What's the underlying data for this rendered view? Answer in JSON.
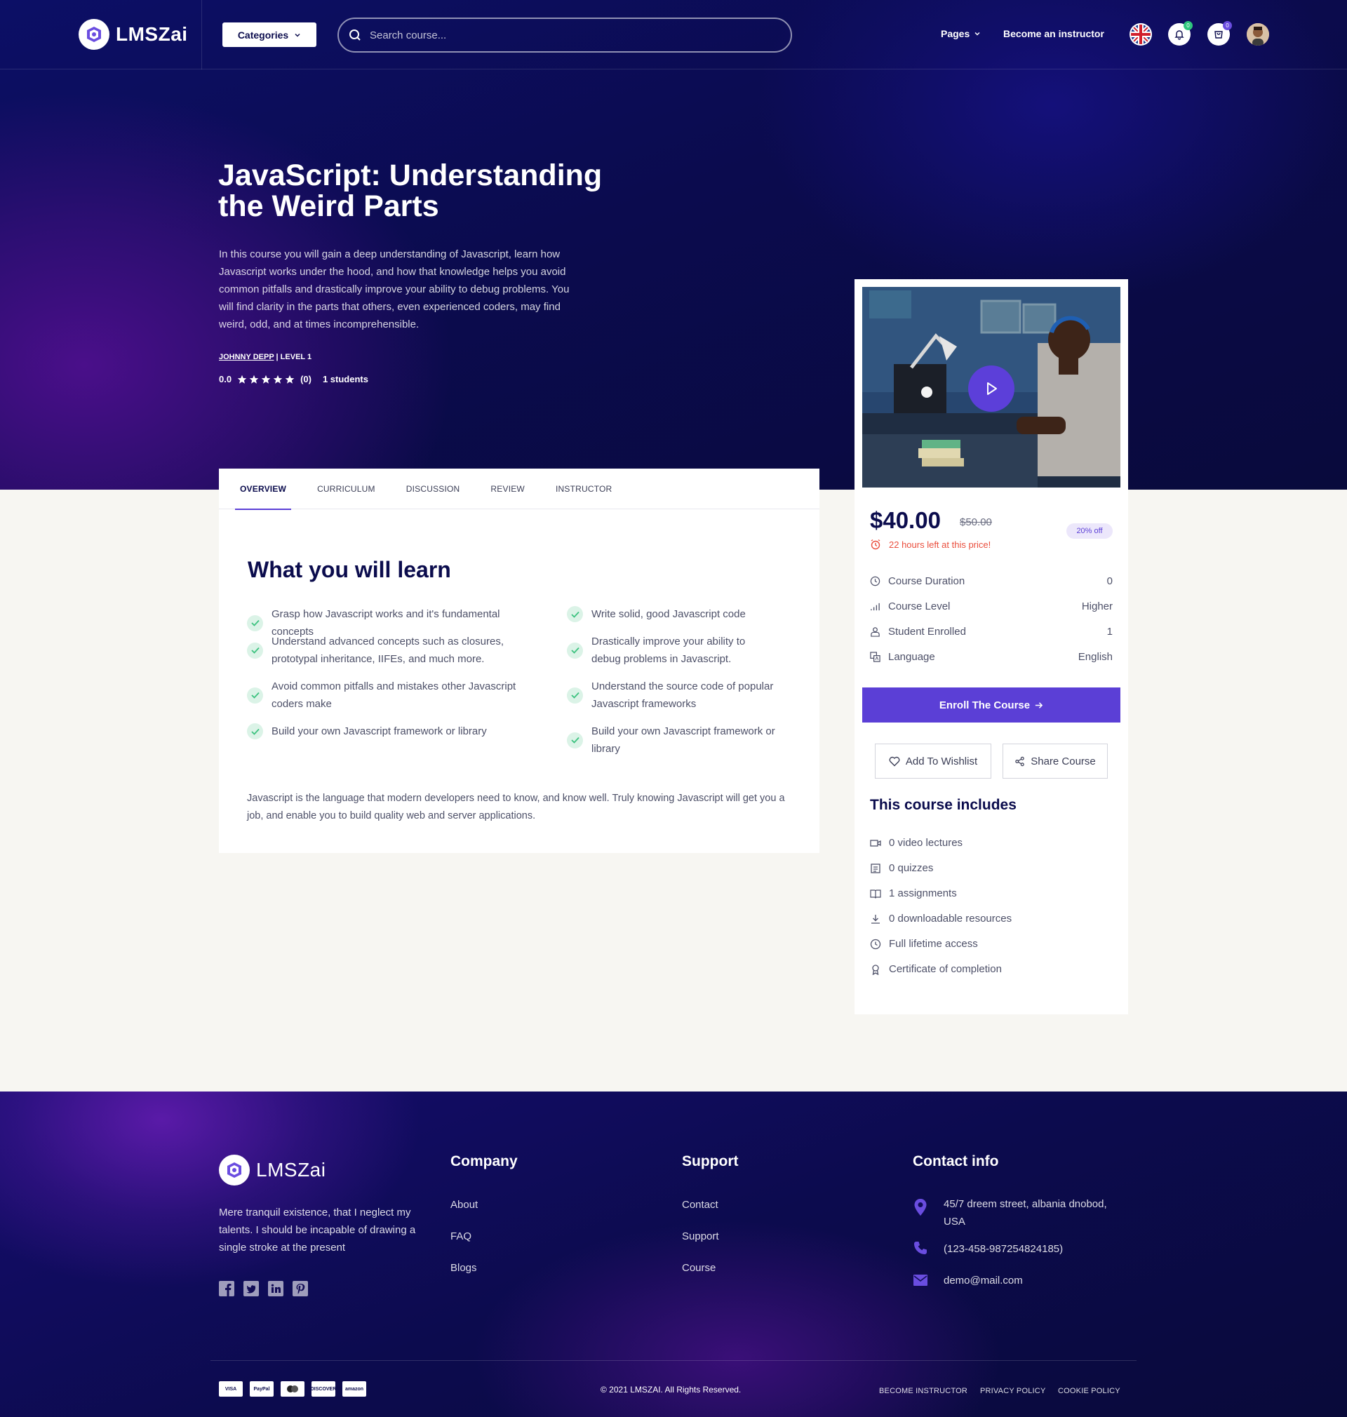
{
  "brand": {
    "name": "LMSZai"
  },
  "nav": {
    "categories_label": "Categories",
    "search_placeholder": "Search course...",
    "pages_label": "Pages",
    "become_instructor": "Become an instructor",
    "notification_count": "0",
    "cart_count": "0"
  },
  "course": {
    "title": "JavaScript: Understanding the Weird Parts",
    "description": "In this course you will gain a deep understanding of Javascript, learn how Javascript works under the hood, and how that knowledge helps you avoid common pitfalls and drastically improve your ability to debug problems. You will find clarity in the parts that others, even experienced coders, may find weird, odd, and at times incomprehensible.",
    "author": "JOHNNY DEPP",
    "level": "LEVEL 1",
    "rating": "0.0",
    "stars": 5,
    "review_count": "(0)",
    "students": "1 students"
  },
  "tabs": [
    "OVERVIEW",
    "CURRICULUM",
    "DISCUSSION",
    "REVIEW",
    "INSTRUCTOR"
  ],
  "overview": {
    "learn_title": "What you will learn",
    "learn_left": [
      "Grasp how Javascript works and it's fundamental concepts",
      "Understand advanced concepts such as closures, prototypal inheritance, IIFEs, and much more.",
      "Avoid common pitfalls and mistakes other Javascript coders make",
      "Build your own Javascript framework or library"
    ],
    "learn_right": [
      "Write solid, good Javascript code",
      "Drastically improve your ability to debug problems in Javascript.",
      "Understand the source code of popular Javascript frameworks",
      "Build your own Javascript framework or library"
    ],
    "paragraph": "Javascript is the language that modern developers need to know, and know well. Truly knowing Javascript will get you a job, and enable you to build quality web and server applications."
  },
  "sidebar": {
    "price": "$40.00",
    "old_price": "$50.00",
    "discount": "20% off",
    "time_left": "22 hours left at this price!",
    "specs": [
      {
        "label": "Course Duration",
        "value": "0",
        "icon": "clock-icon"
      },
      {
        "label": "Course Level",
        "value": "Higher",
        "icon": "level-bars-icon"
      },
      {
        "label": "Student Enrolled",
        "value": "1",
        "icon": "students-icon"
      },
      {
        "label": "Language",
        "value": "English",
        "icon": "language-icon"
      }
    ],
    "enroll_label": "Enroll The Course",
    "wishlist_label": "Add To Wishlist",
    "share_label": "Share Course",
    "includes_title": "This course includes",
    "includes": [
      {
        "text": "0 video lectures",
        "icon": "video-icon"
      },
      {
        "text": "0 quizzes",
        "icon": "quiz-icon"
      },
      {
        "text": "1 assignments",
        "icon": "book-icon"
      },
      {
        "text": "0 downloadable resources",
        "icon": "download-icon"
      },
      {
        "text": "Full lifetime access",
        "icon": "clock-icon"
      },
      {
        "text": "Certificate of completion",
        "icon": "certificate-icon"
      }
    ]
  },
  "footer": {
    "about": "Mere tranquil existence, that I neglect my talents. I should be incapable of drawing a single stroke at the present",
    "company_title": "Company",
    "company_links": [
      "About",
      "FAQ",
      "Blogs"
    ],
    "support_title": "Support",
    "support_links": [
      "Contact",
      "Support",
      "Course"
    ],
    "contact_title": "Contact info",
    "address": "45/7 dreem street, albania dnobod, USA",
    "phone": "(123-458-987254824185)",
    "email": "demo@mail.com",
    "payments": [
      "VISA",
      "PayPal",
      "Master",
      "DISCOVER",
      "amazon"
    ],
    "copyright": "© 2021 LMSZAI. All Rights Reserved.",
    "bottom_links": [
      "BECOME INSTRUCTOR",
      "PRIVACY POLICY",
      "COOKIE POLICY"
    ],
    "accent_color": "#5b3fd6"
  }
}
